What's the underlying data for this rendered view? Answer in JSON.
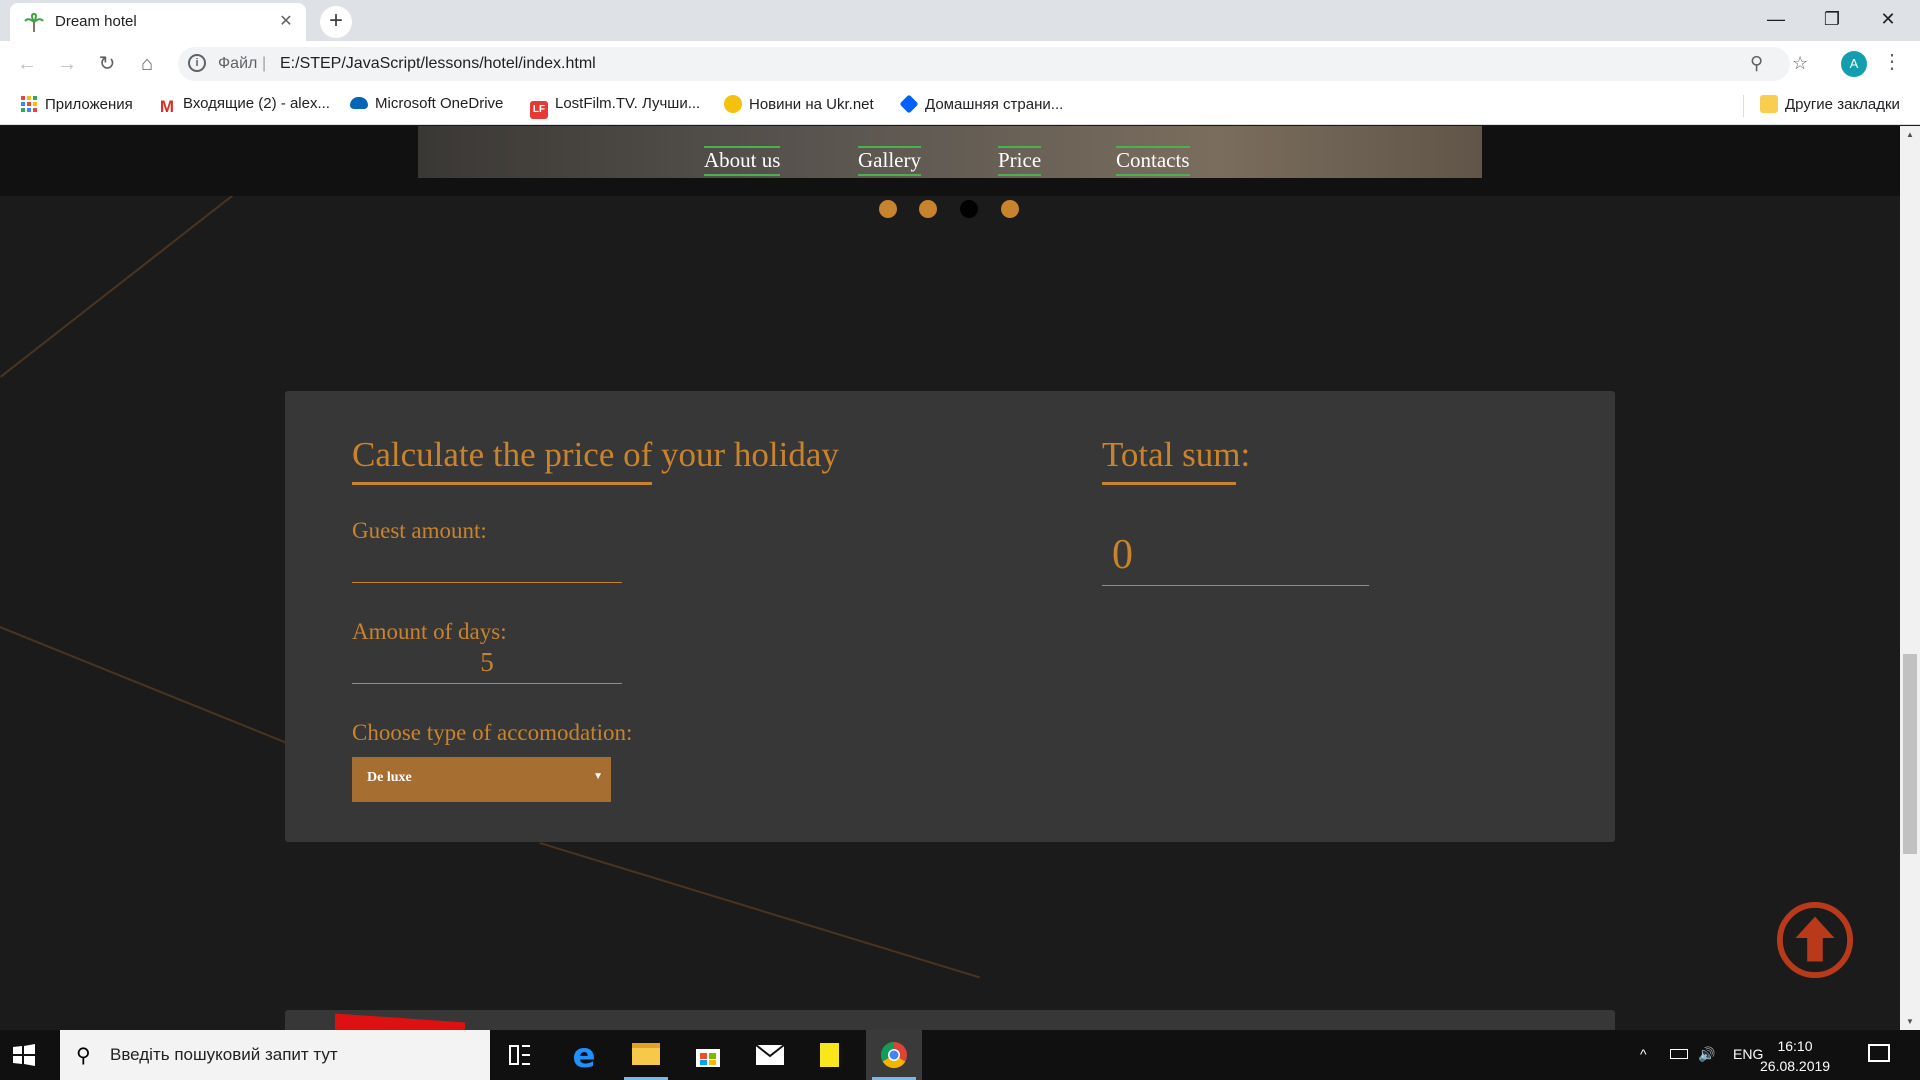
{
  "browser": {
    "tab_title": "Dream hotel",
    "tab_close": "✕",
    "new_tab": "+",
    "window_controls": {
      "minimize": "—",
      "maximize": "❐",
      "close": "✕"
    },
    "nav": {
      "back": "←",
      "forward": "→",
      "reload": "↻",
      "home": "⌂"
    },
    "omnibox": {
      "info_icon": "i",
      "scheme_label": "Файл",
      "separator": "|",
      "url": "E:/STEP/JavaScript/lessons/hotel/index.html"
    },
    "zoom_icon": "⚲",
    "star_icon": "☆",
    "avatar_letter": "A",
    "menu_icon": "⋮",
    "bookmarks": [
      {
        "label": "Приложения",
        "color": "#e8453c"
      },
      {
        "label": "Входящие (2) - alex...",
        "color": "#d93025"
      },
      {
        "label": "Microsoft OneDrive",
        "color": "#0364b8"
      },
      {
        "label": "LostFilm.TV. Лучши...",
        "color": "#e53935"
      },
      {
        "label": "Новини на Ukr.net",
        "color": "#f4c20d"
      },
      {
        "label": "Домашняя страни...",
        "color": "#0061fe"
      }
    ],
    "other_bookmarks": "Другие закладки"
  },
  "page": {
    "nav_links": [
      "About us",
      "Gallery",
      "Price",
      "Contacts"
    ],
    "slider_dots_active_index": 2,
    "calculator": {
      "title": "Calculate the price of your holiday",
      "guest_label": "Guest amount:",
      "guest_value": "",
      "days_label": "Amount of days:",
      "days_value": "5",
      "accommodation_label": "Choose type of accomodation:",
      "accommodation_selected": "De luxe",
      "select_arrow": "▼",
      "total_label": "Total sum:",
      "total_value": "0"
    },
    "colors": {
      "accent": "#c8832e",
      "card": "#373737",
      "select": "#a76e32",
      "nav_underline": "#4caf50"
    }
  },
  "scrollbar": {
    "up": "▲",
    "down": "▼"
  },
  "taskbar": {
    "search_placeholder": "Введіть пошуковий запит тут",
    "search_icon": "⚲",
    "language": "ENG",
    "time": "16:10",
    "date": "26.08.2019",
    "tray_up": "^",
    "tray_volume": "🔊"
  }
}
